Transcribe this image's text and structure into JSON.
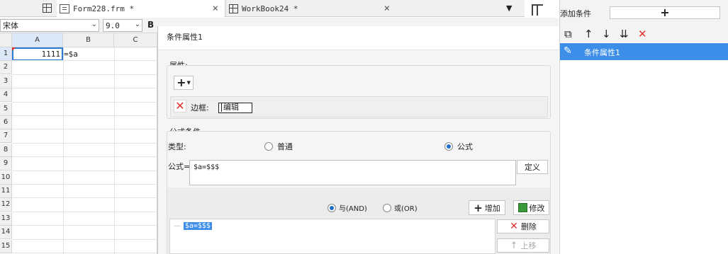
{
  "tabs": [
    {
      "label": "Form228.frm *",
      "close": "×",
      "icon": "form-doc-icon"
    },
    {
      "label": "WorkBook24 *",
      "close": "×",
      "icon": "workbook-icon"
    }
  ],
  "font_toolbar": {
    "font_name": "宋体",
    "font_size": "9.0",
    "bold": "B"
  },
  "sheet": {
    "columns": [
      "A",
      "B",
      "C"
    ],
    "rows": [
      "1",
      "2",
      "3",
      "4",
      "5",
      "6",
      "7",
      "8",
      "9",
      "10",
      "11",
      "12",
      "13",
      "14",
      "15"
    ],
    "cells": {
      "A1": "1111",
      "B1": "=$a"
    }
  },
  "dialog": {
    "title": "条件属性1",
    "attributes": {
      "legend": "属性:",
      "add_symbol": "+",
      "border_label": "边框:",
      "edit_button": "编辑"
    },
    "formula_condition": {
      "legend": "公式条件",
      "type_label": "类型:",
      "option_normal": "普通",
      "option_formula": "公式",
      "selected": "公式",
      "formula_label": "公式=",
      "formula_value": "$a=$$$",
      "define_button": "定义",
      "and_label": "与(AND)",
      "or_label": "或(OR)",
      "logic_selected": "AND",
      "add_button": "增加",
      "modify_button": "修改",
      "condition_items": [
        "$a=$$$"
      ],
      "delete_button": "删除",
      "move_up_button": "上移"
    }
  },
  "right_panel": {
    "add_condition_label": "添加条件",
    "add_symbol": "+",
    "conditions": [
      "条件属性1"
    ],
    "selected_condition": "条件属性1",
    "accent_color": "#3d8ee8"
  }
}
